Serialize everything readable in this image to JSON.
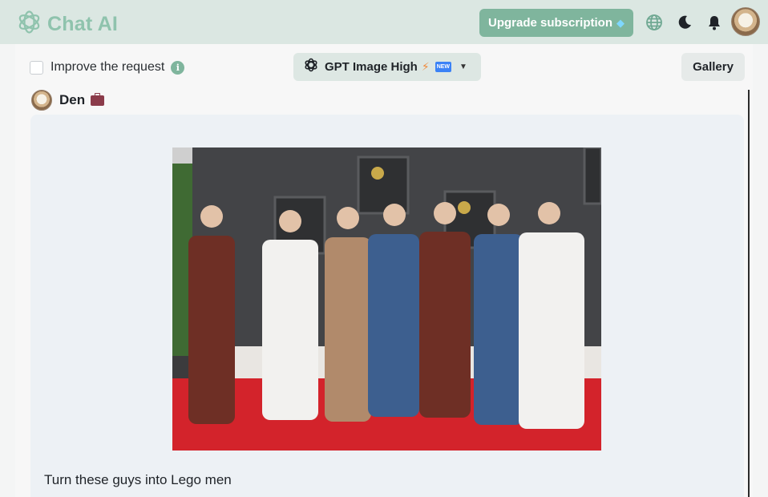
{
  "header": {
    "app_name": "Chat AI",
    "upgrade_label": "Upgrade subscription",
    "icons": [
      "logo-icon",
      "globe-icon",
      "moon-icon",
      "bell-icon",
      "avatar"
    ]
  },
  "toolbar": {
    "improve_label": "Improve the request",
    "improve_checked": false,
    "model_label": "GPT Image High",
    "model_badge": "NEW",
    "gallery_label": "Gallery"
  },
  "message": {
    "username": "Den",
    "prompt": "Turn these guys into Lego men"
  },
  "colors": {
    "header_bg": "#dbe7e2",
    "accent": "#7fb59d",
    "message_bg": "#edf1f5",
    "carpet": "#d3232b"
  }
}
